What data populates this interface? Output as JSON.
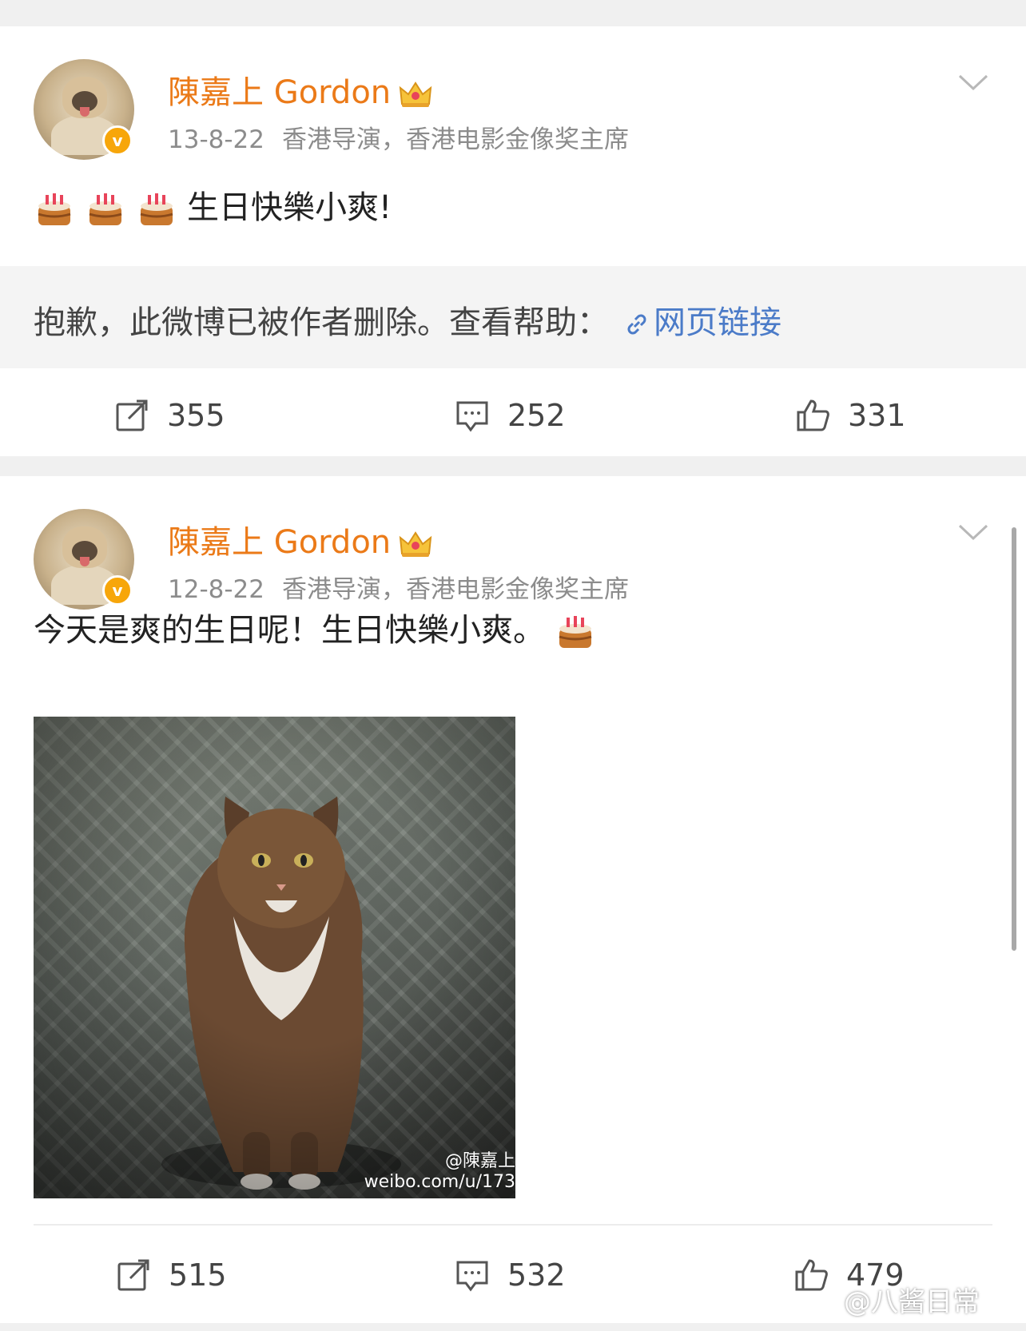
{
  "posts": [
    {
      "username": "陳嘉上 Gordon",
      "time": "13-8-22",
      "description": "香港导演，香港电影金像奖主席",
      "text": "生日快樂小爽!",
      "deleted_notice": "抱歉，此微博已被作者删除。查看帮助：",
      "deleted_link": "网页链接",
      "reposts": "355",
      "comments": "252",
      "likes": "331"
    },
    {
      "username": "陳嘉上 Gordon",
      "time": "12-8-22",
      "description": "香港导演，香港电影金像奖主席",
      "text": "今天是爽的生日呢！生日快樂小爽。",
      "image_watermark_handle": "@陳嘉上",
      "image_watermark_url": "weibo.com/u/173",
      "reposts": "515",
      "comments": "532",
      "likes": "479"
    }
  ],
  "icons": {
    "verified": "verified-v-icon",
    "vip": "crown-icon",
    "emoji": "birthday-cake-emoji",
    "repost": "repost-icon",
    "comment": "comment-icon",
    "like": "thumbs-up-icon",
    "menu": "chevron-down-icon"
  },
  "colors": {
    "username": "#eb7a18",
    "link": "#4b7bc8",
    "meta": "#8c8c8c",
    "verified_badge": "#f7a60a"
  },
  "corner_watermark": "@八酱日常"
}
